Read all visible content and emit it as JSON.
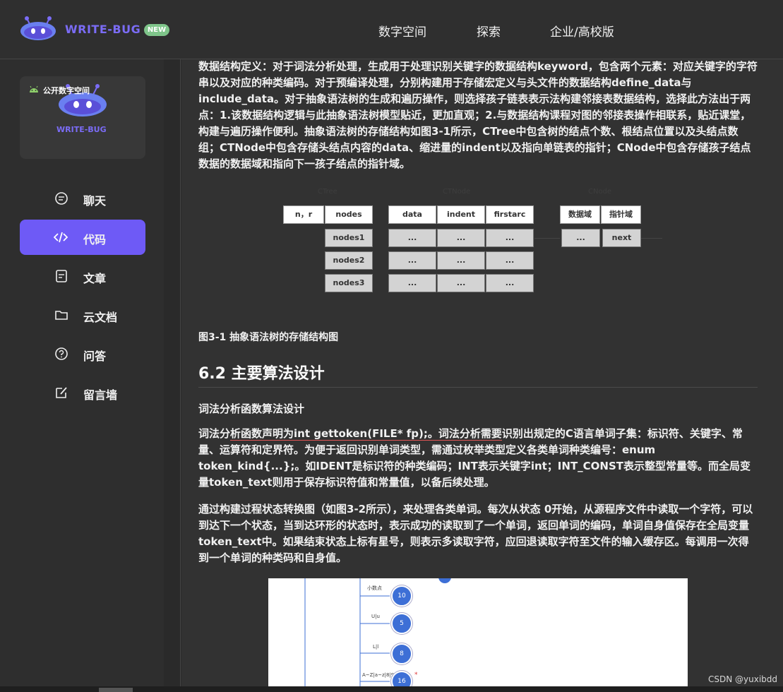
{
  "header": {
    "brand": "WRITE-BUG",
    "badge": "NEW",
    "nav": [
      "数字空间",
      "探索",
      "企业/高校版"
    ]
  },
  "sidebar": {
    "space_label": "公开数字空间",
    "space_brand": "WRITE-BUG",
    "items": [
      {
        "label": "聊天",
        "icon": "chat-icon",
        "active": false
      },
      {
        "label": "代码",
        "icon": "code-icon",
        "active": true
      },
      {
        "label": "文章",
        "icon": "article-icon",
        "active": false
      },
      {
        "label": "云文档",
        "icon": "folder-icon",
        "active": false
      },
      {
        "label": "问答",
        "icon": "question-icon",
        "active": false
      },
      {
        "label": "留言墙",
        "icon": "edit-icon",
        "active": false
      }
    ]
  },
  "article": {
    "para1": "数据结构定义：对于词法分析处理，生成用于处理识别关键字的数据结构keyword，包含两个元素：对应关键字的字符串以及对应的种类编码。对于预编译处理，分别构建用于存储宏定义与头文件的数据结构define_data与include_data。对于抽象语法树的生成和遍历操作，则选择孩子链表表示法构建邻接表数据结构，选择此方法出于两点：1.该数据结构逻辑与此抽象语法树模型贴近，更加直观；2.与数据结构课程对图的邻接表操作相联系，贴近课堂，构建与遍历操作便利。抽象语法树的存储结构如图3-1所示，CTree中包含树的结点个数、根结点位置以及头结点数组；CTNode中包含存储头结点内容的data、缩进量的indent以及指向单链表的指针；CNode中包含存储孩子结点数据的数据域和指向下一孩子结点的指针域。",
    "figure1": {
      "group_labels": [
        "CTree",
        "CTNode",
        "CNode"
      ],
      "ctree_header": [
        "n，r",
        "nodes"
      ],
      "ctree_nodes": [
        "nodes1",
        "nodes2",
        "nodes3"
      ],
      "ctnode_header": [
        "data",
        "indent",
        "firstarc"
      ],
      "ellipsis": "...",
      "cnode_header": [
        "数据域",
        "指针域"
      ],
      "cnode_next": "next",
      "caption": "图3-1 抽象语法树的存储结构图"
    },
    "section_title": "6.2 主要算法设计",
    "subsection_title": "词法分析函数算法设计",
    "para2_pre": "词法分",
    "para2_underlined": "析函数声明为int gettoken(FILE* fp);。词法分析需要",
    "para2_post": "识别出规定的C语言单词子集：标识符、关键字、常量、运算符和定界符。为便于返回识别单词类型，需通过枚举类型定义各类单词种类编号：enum token_kind{...};。如IDENT是标识符的种类编码；INT表示关键字int；INT_CONST表示整型常量等。而全局变量token_text则用于保存标识符值和常量值，以备后续处理。",
    "para3": "通过构建过程状态转换图（如图3-2所示），来处理各类单词。每次从状态 0开始，从源程序文件中读取一个字符，可以到达下一个状态，当到达环形的状态时，表示成功的读取到了一个单词，返回单词的编码，单词自身值保存在全局变量token_text中。如果结束状态上标有星号，则表示多读取字符，应回退读取字符至文件的输入缓存区。每调用一次得到一个单词的种类码和自身值。",
    "figure2": {
      "nodes": [
        "10",
        "5",
        "8",
        "16"
      ],
      "edge_labels": [
        "小数点",
        "U|u",
        "L|l",
        "A~Z|a~z|8|9"
      ],
      "star": "*"
    }
  },
  "watermark": "CSDN @yuxibdd",
  "colors": {
    "accent": "#6e5af6",
    "badge": "#7fc58a",
    "node": "#3d6fd6"
  }
}
